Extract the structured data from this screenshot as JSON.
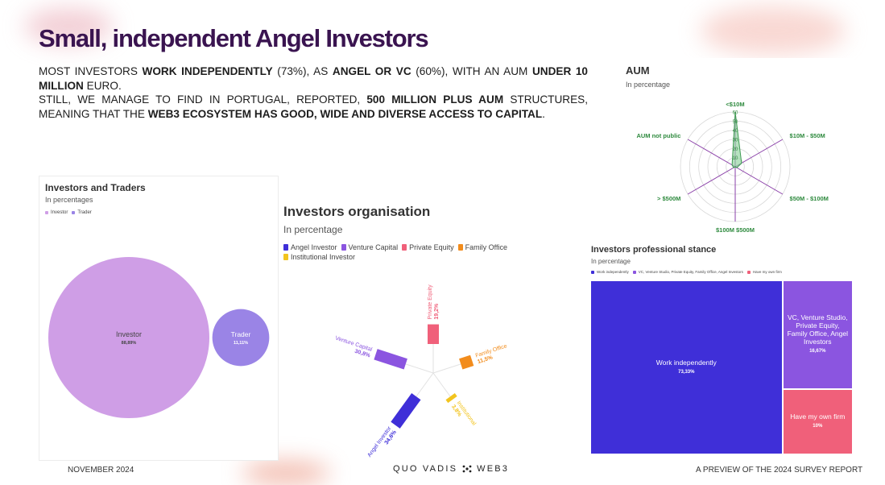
{
  "page": {
    "title": "Small, independent Angel Investors",
    "intro": [
      {
        "t": "Most investors ",
        "b": false
      },
      {
        "t": "work independently",
        "b": true
      },
      {
        "t": " (73%), as ",
        "b": false
      },
      {
        "t": "Angel or VC",
        "b": true
      },
      {
        "t": " (60%), with an AUM ",
        "b": false
      },
      {
        "t": "under 10 million",
        "b": true
      },
      {
        "t": " euro.",
        "b": false
      },
      {
        "t": "\n",
        "b": false
      },
      {
        "t": "Still, we manage to find in Portugal, reported, ",
        "b": false
      },
      {
        "t": "500 million plus AUM",
        "b": true
      },
      {
        "t": " structures, meaning that the ",
        "b": false
      },
      {
        "t": "WEB3 ecosystem has good, wide and diverse access to capital",
        "b": true
      },
      {
        "t": ".",
        "b": false
      }
    ],
    "footer": {
      "left": "NOVEMBER 2024",
      "brand": "QUO VADIS",
      "brand_suffix": "WEB3",
      "right": "A PREVIEW OF THE 2024 SURVEY REPORT"
    },
    "colors": {
      "title": "#3a1450",
      "investor": "#cf9ee6",
      "trader": "#9a84e6",
      "angel": "#3f2fd8",
      "vc": "#8b55e0",
      "pe": "#f0607a",
      "fo": "#f28c1c",
      "inst": "#f2c41e",
      "radar": "#8a3fa8",
      "radar_fill": "#8fd39c"
    }
  },
  "chart_data": [
    {
      "id": "investors-traders",
      "type": "bubble",
      "title": "Investors and Traders",
      "subtitle": "In percentages",
      "legend": [
        "Investor",
        "Trader"
      ],
      "categories": [
        "Investor",
        "Trader"
      ],
      "labels": [
        "88,89%",
        "11,11%"
      ],
      "values": [
        88.89,
        11.11
      ]
    },
    {
      "id": "investors-organisation",
      "type": "bar",
      "layout": "radial",
      "title": "Investors organisation",
      "subtitle": "In percentage",
      "legend": [
        "Angel Investor",
        "Venture Capital",
        "Private Equity",
        "Family Office",
        "Institutional Investor"
      ],
      "categories": [
        "Private Equity",
        "Family Office",
        "Institutional",
        "Angel Investor",
        "Venture Capital"
      ],
      "labels": [
        "19,2%",
        "11,5%",
        "3,8%",
        "34,6%",
        "30,8%"
      ],
      "values": [
        19.2,
        11.5,
        3.8,
        34.6,
        30.8
      ]
    },
    {
      "id": "aum",
      "type": "radar",
      "title": "AUM",
      "subtitle": "In percentage",
      "categories": [
        "<$10M",
        "$10M - $50M",
        "$50M - $100M",
        "$100M $500M",
        "> $500M",
        "AUM not public"
      ],
      "values": [
        60,
        8,
        2,
        0,
        2,
        4
      ],
      "rlim": [
        0,
        60
      ],
      "ticks": [
        "10",
        "20",
        "30",
        "40",
        "50",
        "60"
      ]
    },
    {
      "id": "professional-stance",
      "type": "treemap",
      "title": "Investors professional stance",
      "subtitle": "In percentage",
      "legend": [
        "Work independently",
        "VC, Venture Studio, Private Equity, Family Office, Angel Investors",
        "Have my own firm"
      ],
      "categories": [
        "Work independently",
        "VC, Venture Studio, Private Equity, Family Office, Angel Investors",
        "Have my own firm"
      ],
      "labels": [
        "73,33%",
        "16,67%",
        "10%"
      ],
      "values": [
        73.33,
        16.67,
        10
      ]
    }
  ]
}
